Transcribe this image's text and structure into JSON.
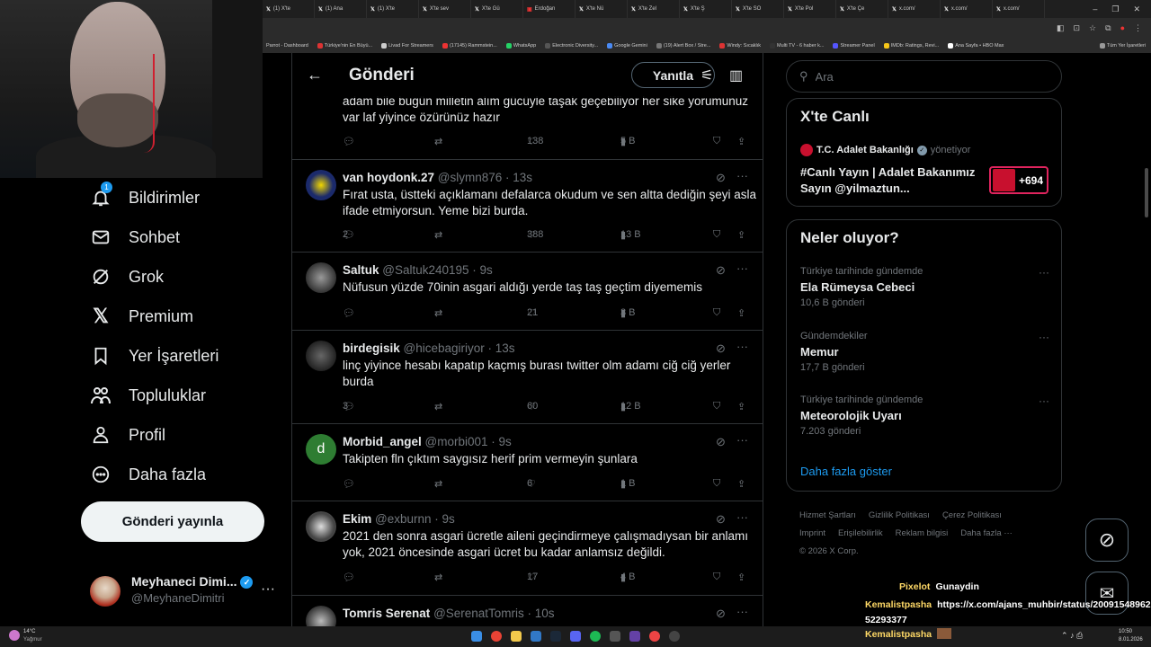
{
  "browser": {
    "tabs": [
      "(1) X'te",
      "(1) Ana",
      "(1) X'te",
      "X'te sev",
      "X'te Gü",
      "Erdoğan",
      "X'te Nü",
      "X'te Zel",
      "X'te Ş",
      "X'te SO",
      "X'te Pol",
      "X'te Çe",
      "x.com/",
      "x.com/",
      "x.com/"
    ],
    "bookmarks": [
      "Parrot - Dashboard",
      "Türkiye'nin En Büyü...",
      "Livad For Streamers",
      "(17145) Rammstein...",
      "WhatsApp",
      "Electronic Diversity...",
      "Google Gemini",
      "(19) Alert Box / Stre...",
      "Windy: Sıcaklık",
      "Multi TV - 6 haber k...",
      "Streamer Panel",
      "IMDb: Ratings, Revi...",
      "Ana Sayfa • HBO Max",
      "Tüm Yer İşaretleri"
    ]
  },
  "nav": {
    "notifications_badge": "1",
    "items": [
      {
        "label": "Bildirimler"
      },
      {
        "label": "Sohbet"
      },
      {
        "label": "Grok"
      },
      {
        "label": "Premium"
      },
      {
        "label": "Yer İşaretleri"
      },
      {
        "label": "Topluluklar"
      },
      {
        "label": "Profil"
      },
      {
        "label": "Daha fazla"
      }
    ],
    "post_button": "Gönderi yayınla",
    "account": {
      "name": "Meyhaneci Dimi...",
      "handle": "@MeyhaneDimitri"
    }
  },
  "header": {
    "title": "Gönderi",
    "reply_button": "Yanıtla"
  },
  "tweets": [
    {
      "name": "",
      "handle": "",
      "time": "",
      "text": "adam bile bugün milletin alım gücüyle taşak geçebiliyor her sike yorumunuz var laf yiyince özürünüz hazır",
      "replies": "",
      "likes": "138",
      "views": "5 B"
    },
    {
      "name": "van hoydonk.27",
      "handle": "@slymn876 · 13s",
      "time": "",
      "text": "Fırat usta, üstteki açıklamanı defalarca okudum ve sen altta dediğin şeyi asla ifade etmiyorsun. Yeme bizi burda.",
      "replies": "2",
      "likes": "388",
      "views": "13 B"
    },
    {
      "name": "Saltuk",
      "handle": "@Saltuk240195 · 9s",
      "time": "",
      "text": "Nüfusun yüzde 70inin asgari aldığı yerde taş taş geçtim diyememis",
      "replies": "",
      "likes": "21",
      "views": "3 B"
    },
    {
      "name": "birdegisik",
      "handle": "@hicebagiriyor · 13s",
      "time": "",
      "text": "linç yiyince hesabı kapatıp kaçmış burası twitter olm adamı ciğ ciğ yerler burda",
      "replies": "3",
      "likes": "60",
      "views": "12 B"
    },
    {
      "name": "Morbid_angel",
      "handle": "@morbi001 · 9s",
      "time": "",
      "text": "Takipten fln çıktım saygısız herif prim vermeyin şunlara",
      "replies": "",
      "likes": "6",
      "views": "1 B"
    },
    {
      "name": "Ekim",
      "handle": "@exburnn · 9s",
      "time": "",
      "text": "2021 den sonra asgari ücretle aileni geçindirmeye çalışmadıysan bir anlamı yok, 2021 öncesinde asgari ücret bu kadar anlamsız değildi.",
      "replies": "",
      "likes": "17",
      "views": "4 B"
    },
    {
      "name": "Tomris Serenat",
      "handle": "@SerenatTomris · 10s",
      "time": "",
      "text": "",
      "replies": "",
      "likes": "",
      "views": ""
    }
  ],
  "avatar_letter": "d",
  "search": {
    "placeholder": "Ara"
  },
  "live": {
    "title": "X'te Canlı",
    "source": "T.C. Adalet Bakanlığı",
    "role": "yönetiyor",
    "text": "#Canlı Yayın | Adalet Bakanımız Sayın @yilmaztun...",
    "count": "+694"
  },
  "trends": {
    "title": "Neler oluyor?",
    "items": [
      {
        "context": "Türkiye tarihinde gündemde",
        "topic": "Ela Rümeysa Cebeci",
        "count": "10,6 B gönderi"
      },
      {
        "context": "Gündemdekiler",
        "topic": "Memur",
        "count": "17,7 B gönderi"
      },
      {
        "context": "Türkiye tarihinde gündemde",
        "topic": "Meteorolojik Uyarı",
        "count": "7.203 gönderi"
      }
    ],
    "show_more": "Daha fazla göster"
  },
  "footer": [
    "Hizmet Şartları",
    "Gizlilik Politikası",
    "Çerez Politikası",
    "Imprint",
    "Erişilebilirlik",
    "Reklam bilgisi",
    "Daha fazla ···",
    "© 2026 X Corp."
  ],
  "chat": [
    {
      "user": "Pixelot",
      "message": "Gunaydin"
    },
    {
      "user": "Kemalistpasha",
      "message": "https://x.com/ajans_muhbir/status/2009154896252293377"
    },
    {
      "user": "Kemalistpasha",
      "message": ""
    }
  ],
  "taskbar": {
    "weather": "14°C",
    "weather_desc": "Yağmur",
    "time": "10:50",
    "date": "8.01.2026"
  },
  "colors": {
    "accent": "#1d9bf0",
    "background": "#000000",
    "border": "#2f3336",
    "muted": "#71767b",
    "live_badge": "#e0245e",
    "chat_user": "#ffd966"
  }
}
